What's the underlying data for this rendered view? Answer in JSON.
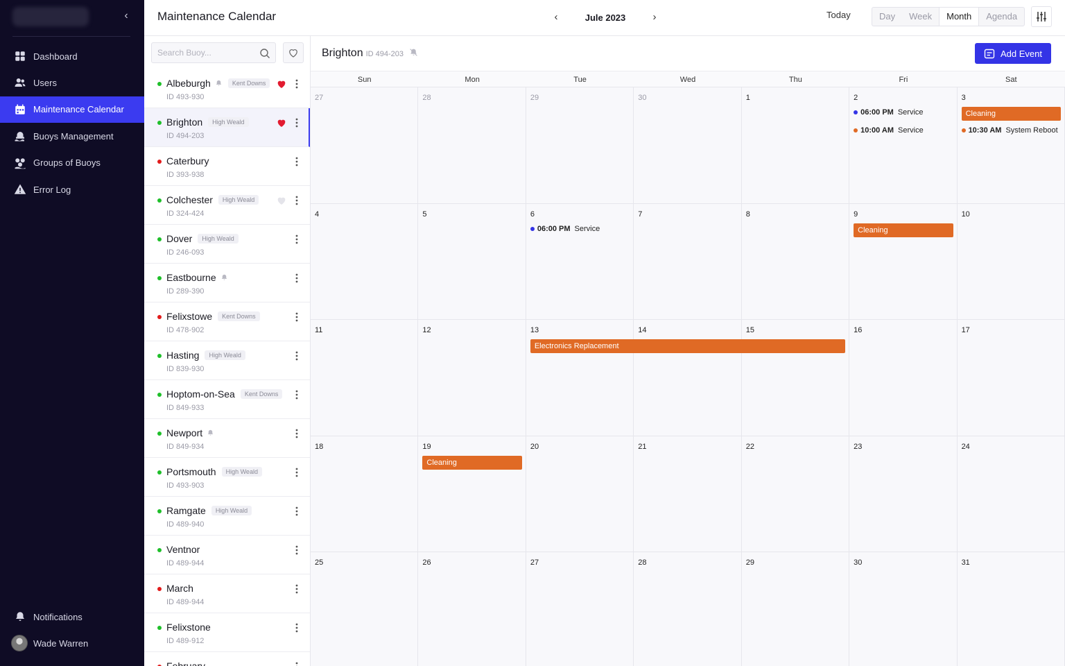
{
  "colors": {
    "accent": "#3b3bf0",
    "sidebar_bg": "#0f0c25",
    "event_orange": "#e06a25",
    "status_green": "#1fbf2a",
    "status_red": "#e21b1b",
    "fav_red": "#e21b30",
    "dot_blue": "#3434e6"
  },
  "sidebar": {
    "nav": [
      {
        "label": "Dashboard",
        "icon": "grid-icon"
      },
      {
        "label": "Users",
        "icon": "users-icon"
      },
      {
        "label": "Maintenance Calendar",
        "icon": "calendar-icon",
        "active": true
      },
      {
        "label": "Buoys Management",
        "icon": "buoy-icon"
      },
      {
        "label": "Groups of Buoys",
        "icon": "buoy-group-icon"
      },
      {
        "label": "Error Log",
        "icon": "warning-icon"
      }
    ],
    "notifications": "Notifications",
    "user_name": "Wade Warren"
  },
  "header": {
    "title": "Maintenance Calendar",
    "month": "Jule 2023",
    "today": "Today",
    "views": [
      "Day",
      "Week",
      "Month",
      "Agenda"
    ],
    "active_view": "Month"
  },
  "search": {
    "placeholder": "Search Buoy..."
  },
  "buoys": [
    {
      "name": "Albeburgh",
      "id": "ID 493-930",
      "status": "green",
      "bell": true,
      "tag": "Kent Downs",
      "fav": "filled"
    },
    {
      "name": "Brighton",
      "id": "ID 494-203",
      "status": "green",
      "bell": false,
      "tag": "High Weald",
      "fav": "filled",
      "selected": true
    },
    {
      "name": "Caterbury",
      "id": "ID 393-938",
      "status": "red",
      "bell": false,
      "tag": "",
      "fav": ""
    },
    {
      "name": "Colchester",
      "id": "ID 324-424",
      "status": "green",
      "bell": false,
      "tag": "High Weald",
      "fav": "outline"
    },
    {
      "name": "Dover",
      "id": "ID 246-093",
      "status": "green",
      "bell": false,
      "tag": "High Weald",
      "fav": ""
    },
    {
      "name": "Eastbourne",
      "id": "ID 289-390",
      "status": "green",
      "bell": true,
      "tag": "",
      "fav": ""
    },
    {
      "name": "Felixstowe",
      "id": "ID 478-902",
      "status": "red",
      "bell": false,
      "tag": "Kent Downs",
      "fav": ""
    },
    {
      "name": "Hasting",
      "id": "ID 839-930",
      "status": "green",
      "bell": false,
      "tag": "High Weald",
      "fav": ""
    },
    {
      "name": "Hoptom-on-Sea",
      "id": "ID 849-933",
      "status": "green",
      "bell": false,
      "tag": "Kent Downs",
      "fav": ""
    },
    {
      "name": "Newport",
      "id": "ID 849-934",
      "status": "green",
      "bell": true,
      "tag": "",
      "fav": ""
    },
    {
      "name": "Portsmouth",
      "id": "ID 493-903",
      "status": "green",
      "bell": false,
      "tag": "High Weald",
      "fav": ""
    },
    {
      "name": "Ramgate",
      "id": "ID 489-940",
      "status": "green",
      "bell": false,
      "tag": "High Weald",
      "fav": ""
    },
    {
      "name": "Ventnor",
      "id": "ID 489-944",
      "status": "green",
      "bell": false,
      "tag": "",
      "fav": ""
    },
    {
      "name": "March",
      "id": "ID 489-944",
      "status": "red",
      "bell": false,
      "tag": "",
      "fav": ""
    },
    {
      "name": "Felixstone",
      "id": "ID 489-912",
      "status": "green",
      "bell": false,
      "tag": "",
      "fav": ""
    },
    {
      "name": "February",
      "id": "",
      "status": "red",
      "bell": false,
      "tag": "",
      "fav": ""
    }
  ],
  "selected_buoy": {
    "name": "Brighton",
    "id": "ID 494-203"
  },
  "add_event": "Add Event",
  "calendar": {
    "weekdays": [
      "Sun",
      "Mon",
      "Tue",
      "Wed",
      "Thu",
      "Fri",
      "Sat"
    ],
    "weeks": [
      [
        {
          "d": "27",
          "m": true
        },
        {
          "d": "28",
          "m": true
        },
        {
          "d": "29",
          "m": true
        },
        {
          "d": "30",
          "m": true
        },
        {
          "d": "1"
        },
        {
          "d": "2"
        },
        {
          "d": "3"
        }
      ],
      [
        {
          "d": "4"
        },
        {
          "d": "5"
        },
        {
          "d": "6"
        },
        {
          "d": "7"
        },
        {
          "d": "8"
        },
        {
          "d": "9"
        },
        {
          "d": "10"
        }
      ],
      [
        {
          "d": "11"
        },
        {
          "d": "12"
        },
        {
          "d": "13"
        },
        {
          "d": "14"
        },
        {
          "d": "15"
        },
        {
          "d": "16"
        },
        {
          "d": "17"
        }
      ],
      [
        {
          "d": "18"
        },
        {
          "d": "19"
        },
        {
          "d": "20"
        },
        {
          "d": "21"
        },
        {
          "d": "22"
        },
        {
          "d": "23"
        },
        {
          "d": "24"
        }
      ],
      [
        {
          "d": "25"
        },
        {
          "d": "26"
        },
        {
          "d": "27"
        },
        {
          "d": "28"
        },
        {
          "d": "29"
        },
        {
          "d": "30"
        },
        {
          "d": "31"
        }
      ]
    ],
    "timed_events": [
      {
        "week": 0,
        "day": 5,
        "slot": 0,
        "time": "06:00 PM",
        "title": "Service",
        "color": "blue"
      },
      {
        "week": 0,
        "day": 5,
        "slot": 1,
        "time": "10:00 AM",
        "title": "Service",
        "color": "orange"
      },
      {
        "week": 0,
        "day": 6,
        "slot": 1,
        "time": "10:30 AM",
        "title": "System Reboot",
        "color": "orange"
      },
      {
        "week": 1,
        "day": 2,
        "slot": 0,
        "time": "06:00 PM",
        "title": "Service",
        "color": "blue"
      }
    ],
    "bar_events": [
      {
        "week": 0,
        "day": 6,
        "span": 1,
        "title": "Cleaning"
      },
      {
        "week": 1,
        "day": 5,
        "span": 1,
        "title": "Cleaning"
      },
      {
        "week": 2,
        "day": 2,
        "span": 3,
        "title": "Electronics Replacement"
      },
      {
        "week": 3,
        "day": 1,
        "span": 1,
        "title": "Cleaning"
      }
    ]
  }
}
